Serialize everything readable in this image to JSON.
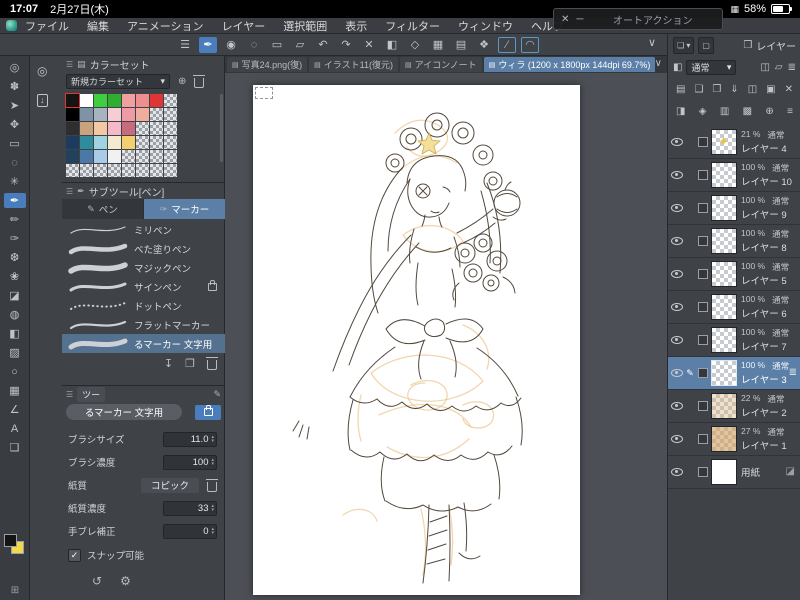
{
  "colors": {
    "accent_blue": "#4a7dbb",
    "selection_blue": "#5b7fa6",
    "canvas_bg": "#ffffff"
  },
  "status_bar": {
    "time": "17:07",
    "date": "2月27日(木)",
    "battery_percent": "58%"
  },
  "menu_bar": {
    "items": [
      "ファイル",
      "編集",
      "アニメーション",
      "レイヤー",
      "選択範囲",
      "表示",
      "フィルター",
      "ウィンドウ",
      "ヘルプ"
    ]
  },
  "auto_action_panel": {
    "title": "オートアクション",
    "close_glyph": "✕",
    "minimize_glyph": "─"
  },
  "command_bar": {
    "icons": [
      {
        "name": "main-menu",
        "glyph": "☰"
      },
      {
        "name": "current-tool-pen",
        "glyph": "✒",
        "selected": true
      },
      {
        "name": "eyedropper",
        "glyph": "◉"
      },
      {
        "name": "select-circle",
        "glyph": "◌"
      },
      {
        "name": "marquee-select",
        "glyph": "▭"
      },
      {
        "name": "crop-frame",
        "glyph": "▱"
      },
      {
        "name": "undo",
        "glyph": "↶"
      },
      {
        "name": "redo",
        "glyph": "↷"
      },
      {
        "name": "clear",
        "glyph": "✕"
      },
      {
        "name": "fill",
        "glyph": "◧"
      },
      {
        "name": "snap-diamond",
        "glyph": "◇"
      },
      {
        "name": "grid",
        "glyph": "▦"
      },
      {
        "name": "material",
        "glyph": "▤"
      },
      {
        "name": "palette-dock",
        "glyph": "❖"
      },
      {
        "name": "snap-line-toggle",
        "glyph": "∕",
        "outlined": true
      },
      {
        "name": "snap-curve-toggle",
        "glyph": "◠",
        "outlined": true
      }
    ],
    "collapse_chevron": "∨"
  },
  "tool_column": {
    "tools": [
      {
        "name": "zoom",
        "glyph": "◎"
      },
      {
        "name": "hand",
        "glyph": "✽"
      },
      {
        "name": "object",
        "glyph": "➤"
      },
      {
        "name": "move-layer",
        "glyph": "✥"
      },
      {
        "name": "marquee",
        "glyph": "▭"
      },
      {
        "name": "lasso",
        "glyph": "◌"
      },
      {
        "name": "auto-select",
        "glyph": "✳"
      },
      {
        "name": "pen",
        "glyph": "✒",
        "selected": true
      },
      {
        "name": "pencil",
        "glyph": "✏"
      },
      {
        "name": "brush",
        "glyph": "✑"
      },
      {
        "name": "airbrush",
        "glyph": "❆"
      },
      {
        "name": "decoration",
        "glyph": "❀"
      },
      {
        "name": "eraser",
        "glyph": "◪"
      },
      {
        "name": "blend",
        "glyph": "◍"
      },
      {
        "name": "fill-bucket",
        "glyph": "◧"
      },
      {
        "name": "gradient",
        "glyph": "▨"
      },
      {
        "name": "figure",
        "glyph": "○"
      },
      {
        "name": "frame",
        "glyph": "▦"
      },
      {
        "name": "ruler",
        "glyph": "∠"
      },
      {
        "name": "text",
        "glyph": "A"
      },
      {
        "name": "balloon",
        "glyph": "❏"
      }
    ],
    "foreground_color": "#141414",
    "background_color": "#f2d84b"
  },
  "quick_dock": {
    "zoom_glyph": "◎",
    "import_glyph": "↓"
  },
  "color_set_panel": {
    "title": "カラーセット",
    "preset_name": "新規カラーセット",
    "selected_index": 0,
    "swatches": [
      "#141414",
      "#ffffff",
      "#3ecf3e",
      "#2fae2f",
      "#f0a0a0",
      "#ee8e8e",
      "#e03535",
      null,
      "#000000",
      "#7e93a6",
      "#a7b3bf",
      "#f6cdd3",
      "#f09aa6",
      "#eeae9e",
      null,
      null,
      "#2e2e2e",
      "#c9a37d",
      "#f2c9a2",
      "#f5b9c8",
      "#c76b7e",
      null,
      null,
      null,
      "#1d3a5f",
      "#2f8c9d",
      "#9ed3df",
      "#f5e9cf",
      "#f2cf6f",
      null,
      null,
      null,
      "#23405c",
      "#4a79a7",
      "#aacbe7",
      "#f1f1f1",
      null,
      null,
      null,
      null,
      null,
      null,
      null,
      null,
      null,
      null,
      null,
      null
    ]
  },
  "subtool_panel": {
    "title": "サブツール[ペン]",
    "tabs": [
      {
        "label": "ペン"
      },
      {
        "label": "マーカー"
      }
    ],
    "active_tab": "マーカー",
    "brushes": [
      {
        "name": "ミリペン",
        "stroke": "thin"
      },
      {
        "name": "べた塗りペン",
        "stroke": "thick"
      },
      {
        "name": "マジックペン",
        "stroke": "bold"
      },
      {
        "name": "サインペン",
        "stroke": "medium",
        "locked": true
      },
      {
        "name": "ドットペン",
        "stroke": "dotted"
      },
      {
        "name": "フラットマーカー",
        "stroke": "flat"
      },
      {
        "name": "るマーカー 文字用",
        "stroke": "marker",
        "selected": true
      }
    ]
  },
  "tool_property_panel": {
    "title": "ツー",
    "tool_name": "るマーカー 文字用",
    "brush_size_label": "ブラシサイズ",
    "brush_size_value": "11.0",
    "brush_opacity_label": "ブラシ濃度",
    "brush_opacity_value": "100",
    "paper_label": "紙質",
    "paper_value": "コピック",
    "paper_opacity_label": "紙質濃度",
    "paper_opacity_value": "33",
    "stabilization_label": "手ブレ補正",
    "stabilization_value": "0",
    "snap_label": "スナップ可能",
    "snap_checked": true
  },
  "canvas": {
    "tabs": [
      {
        "label": "写真24.png(復)"
      },
      {
        "label": "イラスト11(復元)"
      },
      {
        "label": "アイコンノート"
      },
      {
        "label": "ウィラ (1200 x 1800px 144dpi 69.7%)",
        "active": true
      }
    ]
  },
  "layers_panel": {
    "title": "レイヤー",
    "blend_mode": "通常",
    "rowB_icons": [
      {
        "name": "mask-view",
        "glyph": "◫"
      },
      {
        "name": "onion-skin",
        "glyph": "▱"
      },
      {
        "name": "list-view",
        "glyph": "≣"
      }
    ],
    "toolbar_row1": [
      {
        "name": "thumbnail-size",
        "glyph": "▤"
      },
      {
        "name": "new-raster-layer",
        "glyph": "❑"
      },
      {
        "name": "new-layer-folder",
        "glyph": "❒"
      },
      {
        "name": "merge-down",
        "glyph": "⇓"
      },
      {
        "name": "layer-mask",
        "glyph": "◫"
      },
      {
        "name": "lock-layer",
        "glyph": "▣"
      },
      {
        "name": "delete-layer",
        "glyph": "✕"
      }
    ],
    "toolbar_row2": [
      {
        "name": "clip-to-layer",
        "glyph": "◨"
      },
      {
        "name": "reference-layer",
        "glyph": "◈"
      },
      {
        "name": "draft-layer",
        "glyph": "▥"
      },
      {
        "name": "lock-transparent",
        "glyph": "▩"
      },
      {
        "name": "combine",
        "glyph": "⊕"
      },
      {
        "name": "layer-menu",
        "glyph": "≡"
      }
    ],
    "layers": [
      {
        "name": "レイヤー 4",
        "opacity": "21 %",
        "blend": "通常",
        "thumb": "sparkle"
      },
      {
        "name": "レイヤー 10",
        "opacity": "100 %",
        "blend": "通常"
      },
      {
        "name": "レイヤー 9",
        "opacity": "100 %",
        "blend": "通常"
      },
      {
        "name": "レイヤー 8",
        "opacity": "100 %",
        "blend": "通常"
      },
      {
        "name": "レイヤー 5",
        "opacity": "100 %",
        "blend": "通常"
      },
      {
        "name": "レイヤー 6",
        "opacity": "100 %",
        "blend": "通常"
      },
      {
        "name": "レイヤー 7",
        "opacity": "100 %",
        "blend": "通常"
      },
      {
        "name": "レイヤー 3",
        "opacity": "100 %",
        "blend": "通常",
        "selected": true
      },
      {
        "name": "レイヤー 2",
        "opacity": "22 %",
        "blend": "通常",
        "thumb": "tan-light"
      },
      {
        "name": "レイヤー 1",
        "opacity": "27 %",
        "blend": "通常",
        "thumb": "tan"
      },
      {
        "name": "用紙",
        "paper": true
      }
    ]
  }
}
